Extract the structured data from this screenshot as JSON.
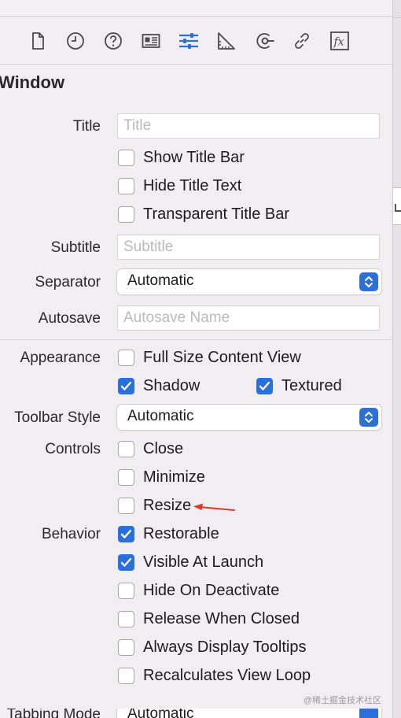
{
  "toolbar": {
    "icons": [
      "file-icon",
      "history-icon",
      "help-icon",
      "identity-icon",
      "attributes-icon",
      "size-icon",
      "connections-icon",
      "bindings-icon",
      "effects-icon"
    ],
    "effects_label": "fx"
  },
  "section": {
    "title": "Window"
  },
  "title_row": {
    "label": "Title",
    "placeholder": "Title"
  },
  "checks_top": [
    {
      "label": "Show Title Bar",
      "checked": false
    },
    {
      "label": "Hide Title Text",
      "checked": false
    },
    {
      "label": "Transparent Title Bar",
      "checked": false
    }
  ],
  "subtitle_row": {
    "label": "Subtitle",
    "placeholder": "Subtitle"
  },
  "separator_row": {
    "label": "Separator",
    "value": "Automatic"
  },
  "autosave_row": {
    "label": "Autosave",
    "placeholder": "Autosave Name"
  },
  "appearance": {
    "label": "Appearance",
    "full_size": {
      "label": "Full Size Content View",
      "checked": false
    },
    "shadow": {
      "label": "Shadow",
      "checked": true
    },
    "textured": {
      "label": "Textured",
      "checked": true
    }
  },
  "toolbar_style": {
    "label": "Toolbar Style",
    "value": "Automatic"
  },
  "controls": {
    "label": "Controls",
    "items": [
      {
        "label": "Close",
        "checked": false
      },
      {
        "label": "Minimize",
        "checked": false
      },
      {
        "label": "Resize",
        "checked": false
      }
    ]
  },
  "behavior": {
    "label": "Behavior",
    "items": [
      {
        "label": "Restorable",
        "checked": true
      },
      {
        "label": "Visible At Launch",
        "checked": true
      },
      {
        "label": "Hide On Deactivate",
        "checked": false
      },
      {
        "label": "Release When Closed",
        "checked": false
      },
      {
        "label": "Always Display Tooltips",
        "checked": false
      },
      {
        "label": "Recalculates View Loop",
        "checked": false
      }
    ]
  },
  "tabbing": {
    "label": "Tabbing Mode",
    "value": "Automatic"
  },
  "watermark": "@稀土掘金技术社区",
  "colors": {
    "accent": "#2a6fdb",
    "annotation_arrow": "#e8342b"
  }
}
